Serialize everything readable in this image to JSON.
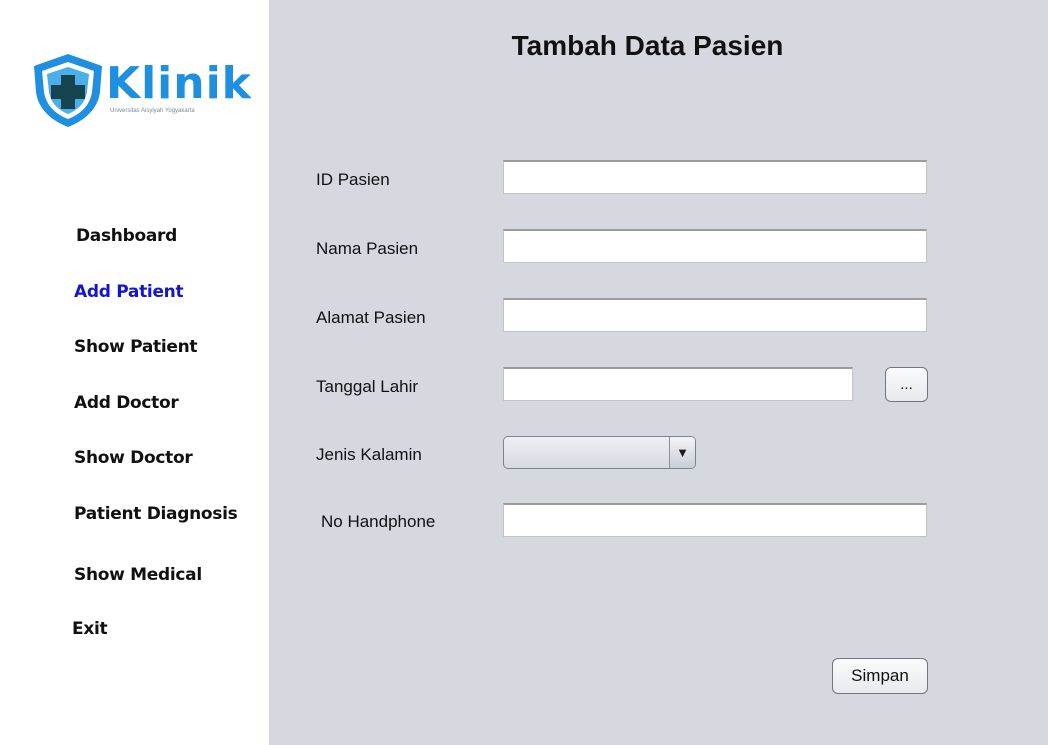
{
  "sidebar": {
    "logo": {
      "text": "Klinik",
      "subtitle": "Universitas Aisyiyah Yogyakarta"
    },
    "items": [
      {
        "label": "Dashboard",
        "active": false
      },
      {
        "label": "Add Patient",
        "active": true
      },
      {
        "label": "Show Patient",
        "active": false
      },
      {
        "label": "Add Doctor",
        "active": false
      },
      {
        "label": "Show Doctor",
        "active": false
      },
      {
        "label": "Patient Diagnosis",
        "active": false
      },
      {
        "label": "Show Medical",
        "active": false
      },
      {
        "label": "Exit",
        "active": false
      }
    ]
  },
  "form": {
    "title": "Tambah Data Pasien",
    "fields": {
      "id_pasien": {
        "label": "ID Pasien",
        "value": ""
      },
      "nama_pasien": {
        "label": "Nama Pasien",
        "value": ""
      },
      "alamat_pasien": {
        "label": "Alamat Pasien",
        "value": ""
      },
      "tanggal_lahir": {
        "label": "Tanggal Lahir",
        "value": "",
        "picker_label": "..."
      },
      "jenis_kelamin": {
        "label": "Jenis Kalamin",
        "value": ""
      },
      "no_handphone": {
        "label": "No Handphone",
        "value": ""
      }
    },
    "submit_label": "Simpan"
  },
  "colors": {
    "accent": "#1e8fe1",
    "active_nav": "#1414d8",
    "panel_bg": "#d5d8df"
  }
}
